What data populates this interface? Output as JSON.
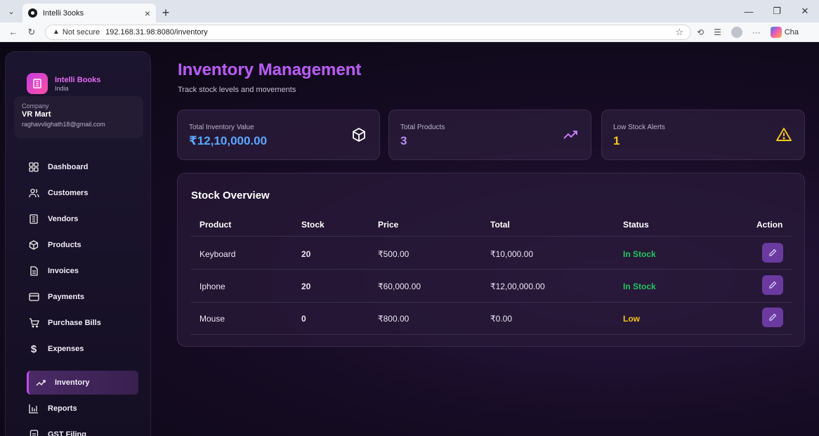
{
  "browser": {
    "tab_title": "Intelli 3ooks",
    "tab_close": "×",
    "new_tab": "+",
    "not_secure": "Not secure",
    "url": "192.168.31.98:8080/inventory",
    "copilot_label": "Cha"
  },
  "brand": {
    "name": "Intelli Books",
    "region": "India"
  },
  "company": {
    "label": "Company",
    "name": "VR Mart",
    "email": "raghavvlighath18@gmail.com"
  },
  "nav": {
    "items": [
      {
        "label": "Dashboard",
        "icon": "grid-icon"
      },
      {
        "label": "Customers",
        "icon": "users-icon"
      },
      {
        "label": "Vendors",
        "icon": "building-icon"
      },
      {
        "label": "Products",
        "icon": "box-icon"
      },
      {
        "label": "Invoices",
        "icon": "document-icon"
      },
      {
        "label": "Payments",
        "icon": "card-icon"
      },
      {
        "label": "Purchase Bills",
        "icon": "cart-icon"
      },
      {
        "label": "Expenses",
        "icon": "dollar-icon"
      },
      {
        "label": "Inventory",
        "icon": "trend-icon",
        "active": true
      },
      {
        "label": "Reports",
        "icon": "bar-chart-icon"
      },
      {
        "label": "GST Filing",
        "icon": "file-icon"
      }
    ]
  },
  "header": {
    "title": "Inventory Management",
    "subtitle": "Track stock levels and movements"
  },
  "stats": {
    "total_value_label": "Total Inventory Value",
    "total_value": "₹12,10,000.00",
    "total_products_label": "Total Products",
    "total_products": "3",
    "low_stock_label": "Low Stock Alerts",
    "low_stock": "1"
  },
  "stock": {
    "title": "Stock Overview",
    "columns": [
      "Product",
      "Stock",
      "Price",
      "Total",
      "Status",
      "Action"
    ],
    "rows": [
      {
        "product": "Keyboard",
        "stock": "20",
        "price": "₹500.00",
        "total": "₹10,000.00",
        "status": "In Stock"
      },
      {
        "product": "Iphone",
        "stock": "20",
        "price": "₹60,000.00",
        "total": "₹12,00,000.00",
        "status": "In Stock"
      },
      {
        "product": "Mouse",
        "stock": "0",
        "price": "₹800.00",
        "total": "₹0.00",
        "status": "Low"
      }
    ]
  },
  "colors": {
    "accent": "#b65bf0",
    "in_stock": "#22c55e",
    "low": "#f5c518",
    "stat_value_blue": "#5aa8ff",
    "stat_value_purple": "#b68cf5"
  }
}
